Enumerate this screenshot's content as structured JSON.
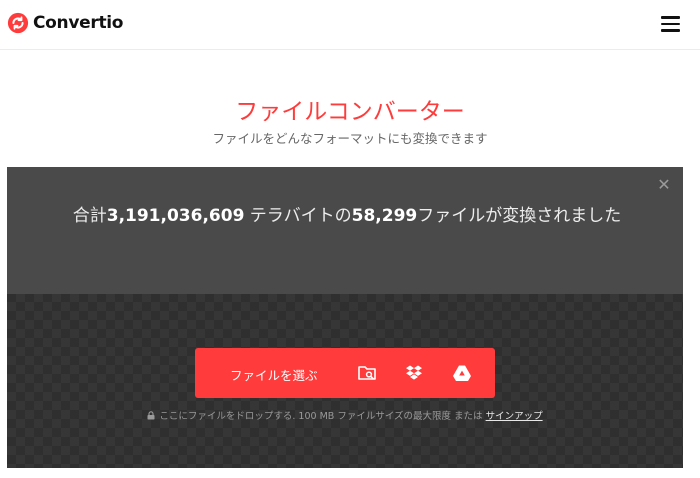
{
  "header": {
    "brand": "Convertio",
    "menu_icon": "hamburger-menu-icon"
  },
  "hero": {
    "title": "ファイルコンバーター",
    "subtitle": "ファイルをどんなフォーマットにも変換できます"
  },
  "banner": {
    "prefix": "合計",
    "total_size": "3,191,036,609",
    "middle": " テラバイトの",
    "file_count": "58,299",
    "suffix": "ファイルが変換されました",
    "close_icon": "close-icon"
  },
  "upload": {
    "choose_label": "ファイルを選ぶ",
    "icons": [
      "folder-search-icon",
      "dropbox-icon",
      "google-drive-icon"
    ],
    "hint_text": "ここにファイルをドロップする. 100 MB ファイルサイズの最大限度 または",
    "signup_label": "サインアップ"
  },
  "colors": {
    "accent": "#ff3b3b",
    "panel": "#2f2f2f",
    "banner": "#4a4a4a"
  }
}
